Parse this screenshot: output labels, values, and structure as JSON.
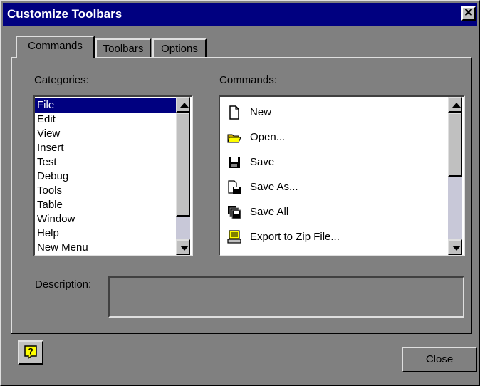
{
  "window": {
    "title": "Customize Toolbars",
    "close_glyph": "✕"
  },
  "tabs": [
    {
      "label": "Commands",
      "active": true
    },
    {
      "label": "Toolbars",
      "active": false
    },
    {
      "label": "Options",
      "active": false
    }
  ],
  "categories": {
    "label": "Categories:",
    "items": [
      "File",
      "Edit",
      "View",
      "Insert",
      "Test",
      "Debug",
      "Tools",
      "Table",
      "Window",
      "Help",
      "New Menu"
    ],
    "selected": "File"
  },
  "commands": {
    "label": "Commands:",
    "items": [
      {
        "label": "New",
        "icon": "new-document-icon"
      },
      {
        "label": "Open...",
        "icon": "open-folder-icon"
      },
      {
        "label": "Save",
        "icon": "save-disk-icon"
      },
      {
        "label": "Save As...",
        "icon": "save-as-icon"
      },
      {
        "label": "Save All",
        "icon": "save-all-icon"
      },
      {
        "label": "Export to Zip File...",
        "icon": "export-zip-icon"
      }
    ]
  },
  "description": {
    "label": "Description:",
    "value": ""
  },
  "footer": {
    "close_label": "Close",
    "help_icon": "help-icon"
  },
  "colors": {
    "title_bar": "#000080",
    "dialog_bg": "#808080",
    "selection": "#000080"
  }
}
